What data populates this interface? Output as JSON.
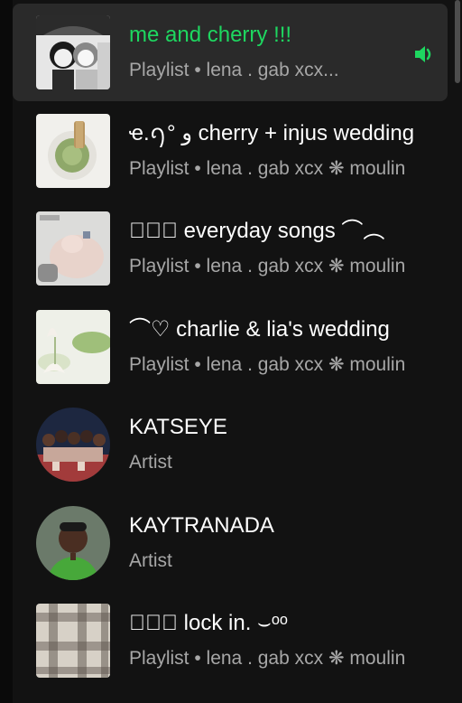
{
  "items": [
    {
      "title": "me and cherry !!!",
      "subtitle": "Playlist • lena . gab xcx...",
      "kind": "playlist",
      "playing": true,
      "thumb": "manga-art"
    },
    {
      "title": "ҽ.ꪆ° ﻭ cherry + injus wedding",
      "subtitle": "Playlist • lena . gab xcx ❋ moulin",
      "kind": "playlist",
      "thumb": "matcha-cup"
    },
    {
      "title": "✿ུ⍰ everyday   songs ⌒︵",
      "subtitle": "Playlist • lena . gab xcx ❋ moulin",
      "kind": "playlist",
      "thumb": "hands-photo"
    },
    {
      "title": "⌒♡ charlie & lia's wedding",
      "subtitle": "Playlist • lena . gab xcx ❋ moulin",
      "kind": "playlist",
      "thumb": "lotus-photo"
    },
    {
      "title": "KATSEYE",
      "subtitle": "Artist",
      "kind": "artist",
      "thumb": "group-photo"
    },
    {
      "title": "KAYTRANADA",
      "subtitle": "Artist",
      "kind": "artist",
      "thumb": "portrait-photo"
    },
    {
      "title": "✿ུ⍰   lock   in. ⌣ᵒᵒ",
      "subtitle": "Playlist • lena . gab xcx ❋ moulin",
      "kind": "playlist",
      "thumb": "plaid-pattern"
    }
  ],
  "colors": {
    "playing": "#1ed760",
    "title": "#ffffff",
    "subtitle": "#a7a7a7",
    "background": "#121212",
    "active_row": "#2a2a2a"
  },
  "icons": {
    "now_playing": "speaker-icon"
  }
}
